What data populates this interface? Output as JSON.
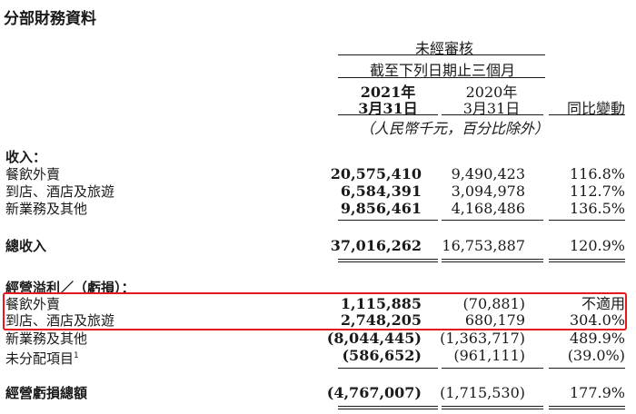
{
  "title": "分部財務資料",
  "header": {
    "unaudited": "未經審核",
    "period": "截至下列日期止三個月",
    "col1_year": "2021年",
    "col1_date": "3月31日",
    "col2_year": "2020年",
    "col2_date": "3月31日",
    "col3": "同比變動",
    "units": "（人民幣千元，百分比除外）"
  },
  "sections": {
    "revenue_title": "收入：",
    "revenue_rows": [
      {
        "label": "餐飲外賣",
        "v2021": "20,575,410",
        "v2020": "9,490,423",
        "change": "116.8%"
      },
      {
        "label": "到店、酒店及旅遊",
        "v2021": "6,584,391",
        "v2020": "3,094,978",
        "change": "112.7%"
      },
      {
        "label": "新業務及其他",
        "v2021": "9,856,461",
        "v2020": "4,168,486",
        "change": "136.5%"
      }
    ],
    "total_revenue": {
      "label": "總收入",
      "v2021": "37,016,262",
      "v2020": "16,753,887",
      "change": "120.9%"
    },
    "op_title": "經營溢利／（虧損）：",
    "op_rows": [
      {
        "label": "餐飲外賣",
        "v2021": "1,115,885",
        "v2020": "(70,881)",
        "change": "不適用"
      },
      {
        "label": "到店、酒店及旅遊",
        "v2021": "2,748,205",
        "v2020": "680,179",
        "change": "304.0%"
      },
      {
        "label": "新業務及其他",
        "v2021": "(8,044,445)",
        "v2020": "(1,363,717)",
        "change": "489.9%"
      },
      {
        "label": "未分配項目",
        "footnote": "1",
        "v2021": "(586,652)",
        "v2020": "(961,111)",
        "change": "(39.0%)"
      }
    ],
    "total_op": {
      "label": "經營虧損總額",
      "v2021": "(4,767,007)",
      "v2020": "(1,715,530)",
      "change": "177.9%"
    }
  },
  "highlight_color": "#e5181e"
}
